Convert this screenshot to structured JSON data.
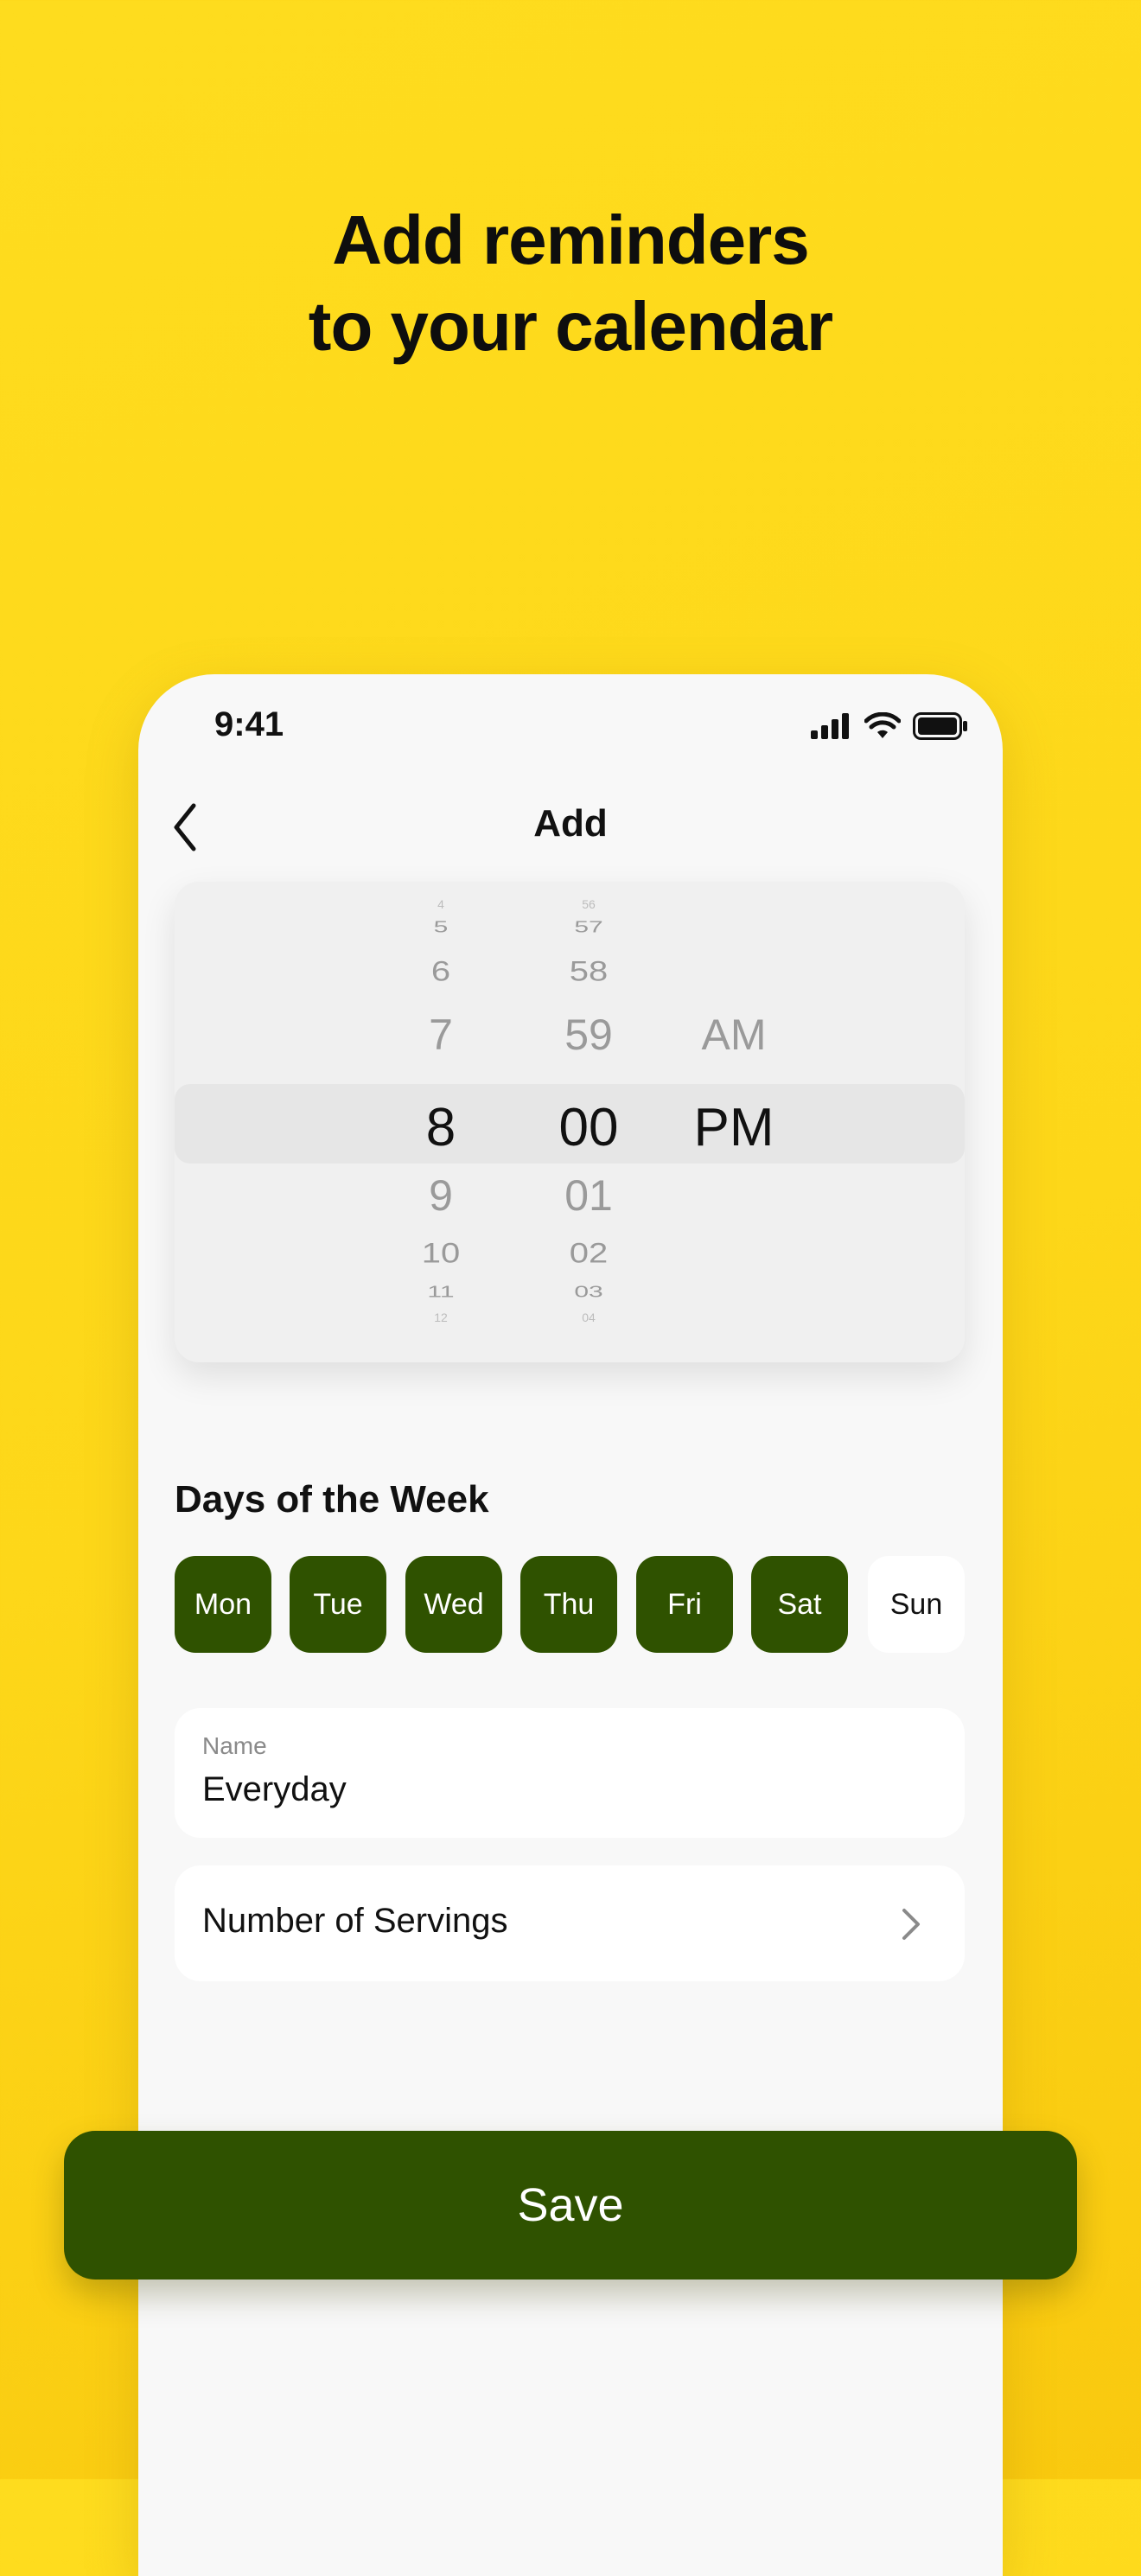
{
  "headline": {
    "line1": "Add reminders",
    "line2": "to your calendar"
  },
  "status_bar": {
    "time": "9:41",
    "icons": [
      "signal-icon",
      "wifi-icon",
      "battery-icon"
    ]
  },
  "nav": {
    "title": "Add",
    "back_icon": "chevron-left-icon"
  },
  "time_picker": {
    "hours": [
      "4",
      "5",
      "6",
      "7",
      "8",
      "9",
      "10",
      "11",
      "12"
    ],
    "minutes": [
      "56",
      "57",
      "58",
      "59",
      "00",
      "01",
      "02",
      "03",
      "04"
    ],
    "periods": [
      "AM",
      "PM"
    ],
    "selected": {
      "hour": "8",
      "minute": "00",
      "period": "PM"
    }
  },
  "days_section": {
    "label": "Days of the Week",
    "days": [
      {
        "label": "Mon",
        "selected": true
      },
      {
        "label": "Tue",
        "selected": true
      },
      {
        "label": "Wed",
        "selected": true
      },
      {
        "label": "Thu",
        "selected": true
      },
      {
        "label": "Fri",
        "selected": true
      },
      {
        "label": "Sat",
        "selected": true
      },
      {
        "label": "Sun",
        "selected": false
      }
    ]
  },
  "name_field": {
    "label": "Name",
    "value": "Everyday"
  },
  "servings": {
    "label": "Number of Servings",
    "icon": "chevron-right-icon"
  },
  "save_button": {
    "label": "Save"
  },
  "colors": {
    "background": "#FDD719",
    "accent": "#2F5200",
    "card": "#FFFFFF",
    "surface": "#F8F8F8"
  }
}
